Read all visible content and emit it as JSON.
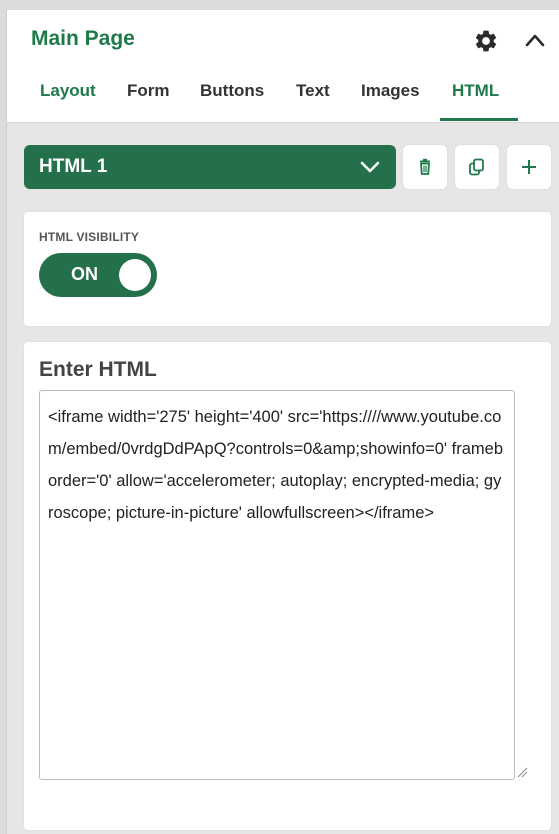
{
  "header": {
    "title": "Main Page",
    "icons": {
      "settings": "gear-icon",
      "collapse": "chevron-up-icon"
    }
  },
  "tabs": [
    {
      "label": "Layout"
    },
    {
      "label": "Form"
    },
    {
      "label": "Buttons"
    },
    {
      "label": "Text"
    },
    {
      "label": "Images"
    },
    {
      "label": "HTML",
      "active": true
    }
  ],
  "element_select": {
    "value": "HTML 1"
  },
  "actions": {
    "delete_icon": "trash-icon",
    "duplicate_icon": "copy-icon",
    "add_icon": "plus-icon"
  },
  "visibility": {
    "label": "HTML VISIBILITY",
    "toggle_text": "ON",
    "on": true
  },
  "html_editor": {
    "title": "Enter HTML",
    "value": "<iframe width='275' height='400' src='https:////www.youtube.com/embed/0vrdgDdPApQ?controls=0&amp;showinfo=0' frameborder='0' allow='accelerometer; autoplay; encrypted-media; gyroscope; picture-in-picture' allowfullscreen></iframe>"
  },
  "colors": {
    "accent": "#1f7a4a",
    "accent_dark": "#23704a"
  }
}
